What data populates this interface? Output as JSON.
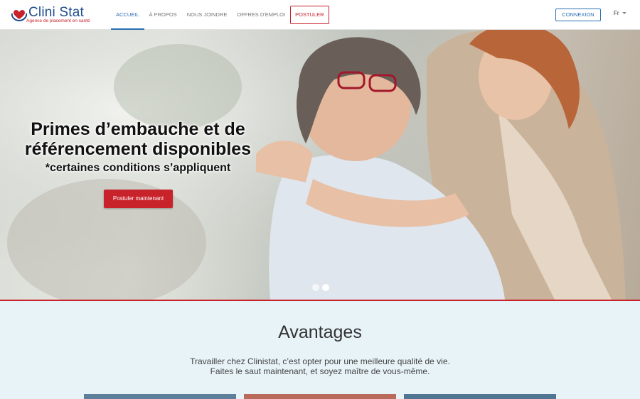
{
  "brand": {
    "name": "Clini Stat",
    "tagline": "Agence de placement en santé",
    "colors": {
      "blue": "#1f4e8c",
      "red": "#c8222a",
      "link": "#2b6fb3"
    }
  },
  "nav": {
    "items": [
      {
        "label": "ACCUEIL",
        "active": true
      },
      {
        "label": "À PROPOS"
      },
      {
        "label": "NOUS JOINDRE"
      },
      {
        "label": "OFFRES D'EMPLOI"
      },
      {
        "label": "POSTULER",
        "highlight": true
      }
    ],
    "login_label": "CONNEXION",
    "language": "Fr"
  },
  "hero": {
    "title_line1": "Primes d’embauche et de",
    "title_line2": "référencement disponibles",
    "subtitle": "*certaines conditions s’appliquent",
    "cta_label": "Postuler maintenant",
    "slides": 2,
    "active_slide": 2
  },
  "advantages": {
    "title": "Avantages",
    "line1": "Travailler chez Clinistat, c’est opter pour une meilleure qualité de vie.",
    "line2": "Faites le saut maintenant, et soyez maître de vous-même."
  }
}
